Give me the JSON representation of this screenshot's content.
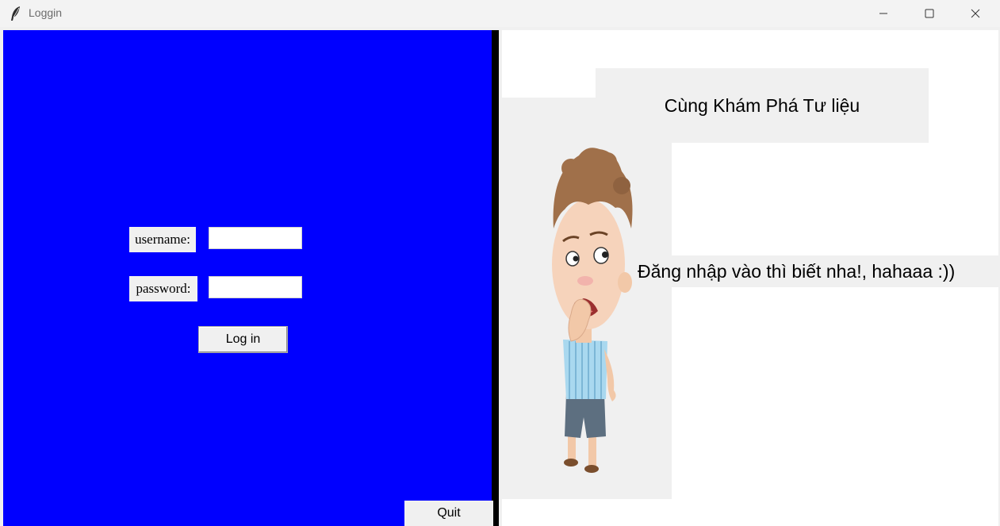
{
  "window": {
    "title": "Loggin"
  },
  "login_form": {
    "username_label": "username:",
    "password_label": "password:",
    "username_value": "",
    "password_value": "",
    "login_button": "Log in",
    "quit_button": "Quit"
  },
  "right_panel": {
    "heading": "Cùng Khám Phá Tư liệu",
    "message": "Đăng nhập vào thì biết nha!, hahaaa :))"
  },
  "colors": {
    "left_panel": "#0000ff",
    "divider": "#000000",
    "right_panel": "#ffffff",
    "widget_bg": "#f0f0f0"
  },
  "icons": {
    "app": "feather-icon",
    "minimize": "minimize-icon",
    "maximize": "maximize-icon",
    "close": "close-icon"
  }
}
